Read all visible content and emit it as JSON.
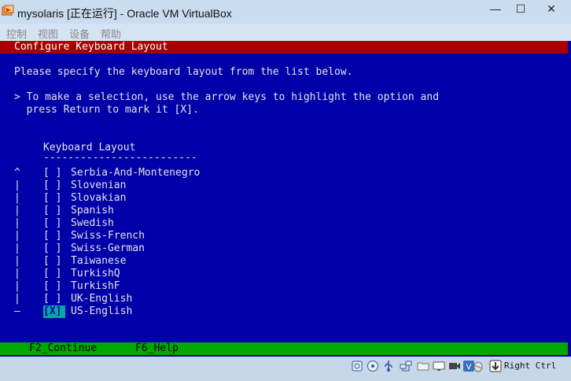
{
  "window": {
    "title": "mysolaris [正在运行] - Oracle VM VirtualBox",
    "minimize_glyph": "—",
    "maximize_glyph": "☐",
    "close_glyph": "✕"
  },
  "menu": {
    "items": [
      "控制",
      "视图",
      "设备",
      "帮助"
    ]
  },
  "installer": {
    "header": "Configure Keyboard Layout",
    "instruction": "Please specify the keyboard layout from the list below.",
    "hint_line1": "> To make a selection, use the arrow keys to highlight the option and",
    "hint_line2": "  press Return to mark it [X].",
    "column_header": "Keyboard Layout",
    "column_rule": "-------------------------",
    "list": [
      {
        "scroll": "^",
        "box": "[ ]",
        "label": "Serbia-And-Montenegro",
        "selected": false
      },
      {
        "scroll": "|",
        "box": "[ ]",
        "label": "Slovenian",
        "selected": false
      },
      {
        "scroll": "|",
        "box": "[ ]",
        "label": "Slovakian",
        "selected": false
      },
      {
        "scroll": "|",
        "box": "[ ]",
        "label": "Spanish",
        "selected": false
      },
      {
        "scroll": "|",
        "box": "[ ]",
        "label": "Swedish",
        "selected": false
      },
      {
        "scroll": "|",
        "box": "[ ]",
        "label": "Swiss-French",
        "selected": false
      },
      {
        "scroll": "|",
        "box": "[ ]",
        "label": "Swiss-German",
        "selected": false
      },
      {
        "scroll": "|",
        "box": "[ ]",
        "label": "Taiwanese",
        "selected": false
      },
      {
        "scroll": "|",
        "box": "[ ]",
        "label": "TurkishQ",
        "selected": false
      },
      {
        "scroll": "|",
        "box": "[ ]",
        "label": "TurkishF",
        "selected": false
      },
      {
        "scroll": "|",
        "box": "[ ]",
        "label": "UK-English",
        "selected": false
      },
      {
        "scroll": "—",
        "box": "[X]",
        "label": "US-English",
        "selected": true
      }
    ],
    "footer": {
      "continue": "F2_Continue",
      "help": "F6_Help"
    }
  },
  "status": {
    "icons": [
      "hard-disk-icon",
      "optical-drive-icon",
      "usb-icon",
      "network-icon",
      "shared-folders-icon",
      "display-icon",
      "video-capture-icon",
      "vrde-icon",
      "mouse-integration-icon",
      "keyboard-capture-icon"
    ],
    "host_key": "Right Ctrl"
  },
  "colors": {
    "guest_background": "#0000a8",
    "header_bar": "#a80000",
    "footer_bar": "#00a800",
    "selection": "#00a8a8"
  }
}
